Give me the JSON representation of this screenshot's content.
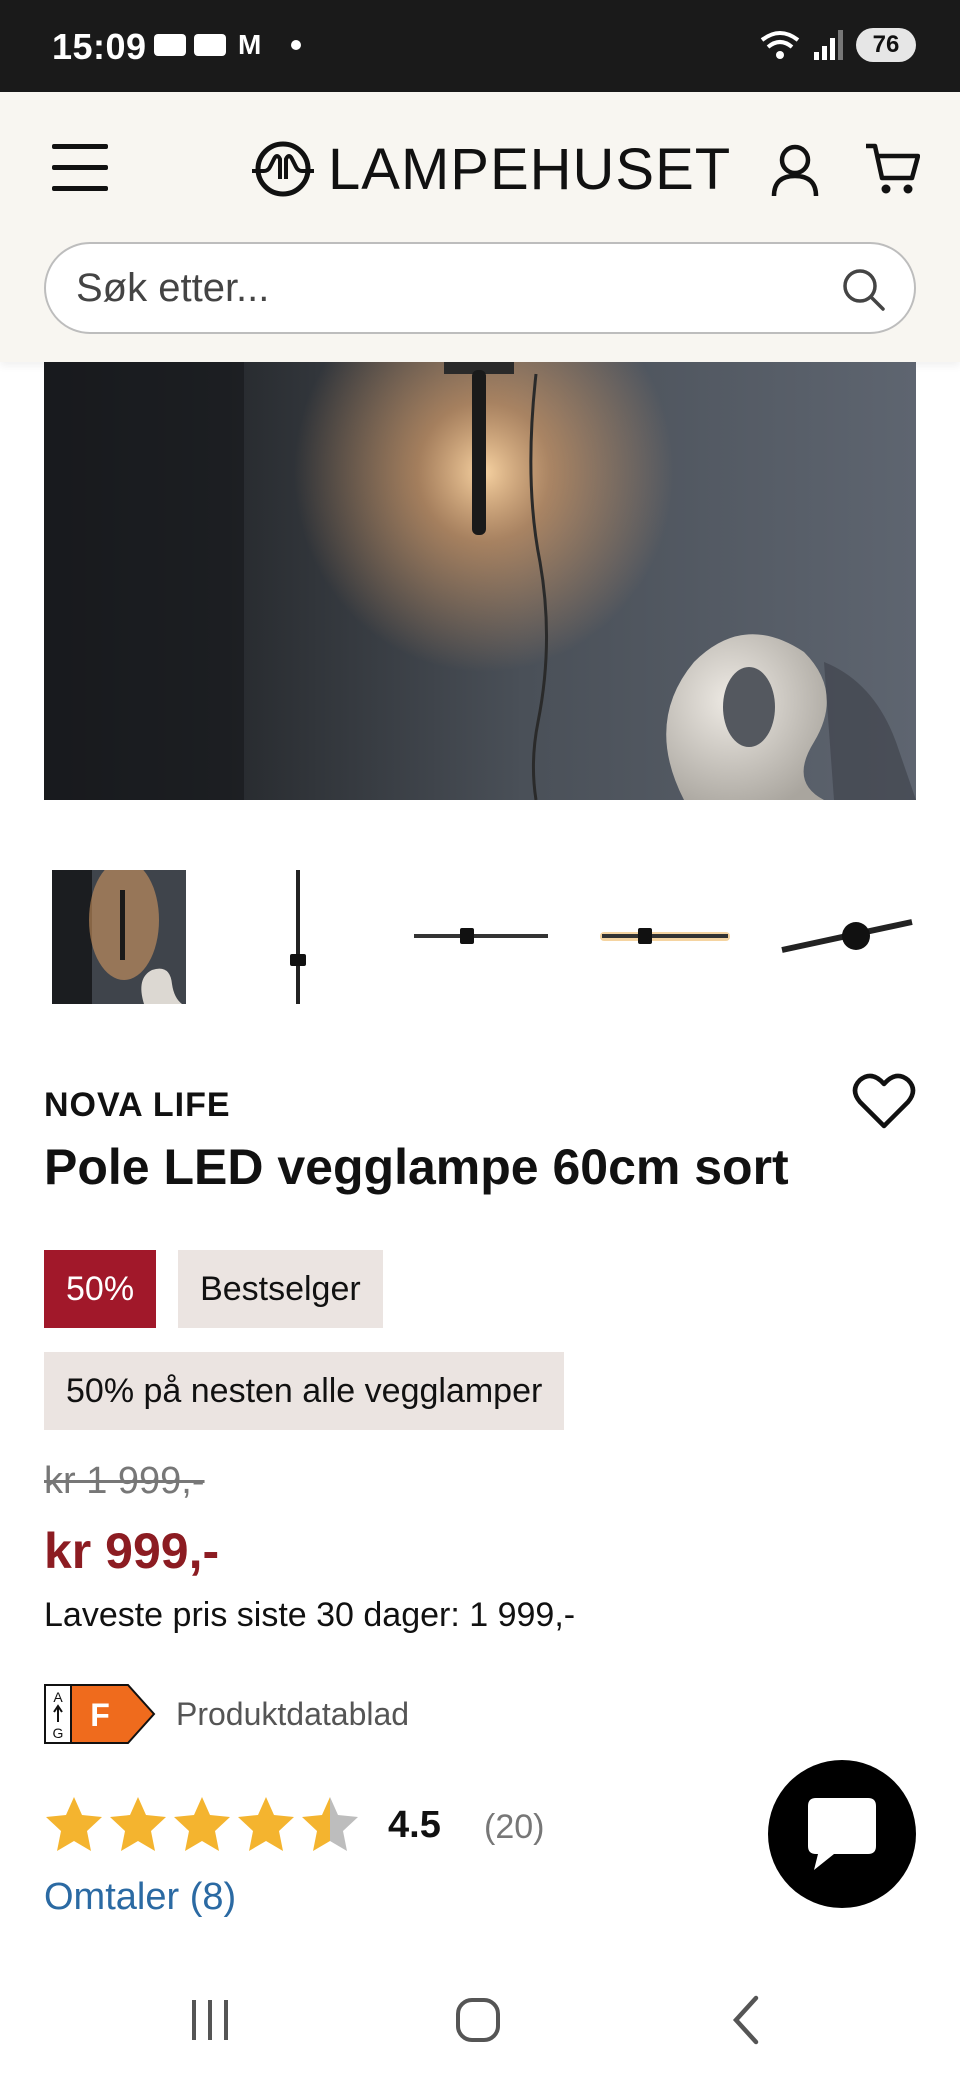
{
  "status_bar": {
    "time": "15:09",
    "notification_icon": "M",
    "battery": "76"
  },
  "header": {
    "brand_name": "LAMPEHUSET",
    "search_placeholder": "Søk etter..."
  },
  "product": {
    "brand": "NOVA LIFE",
    "title": "Pole LED vegglampe 60cm sort",
    "badges": {
      "discount": "50%",
      "bestseller": "Bestselger"
    },
    "promo": "50% på nesten alle vegglamper",
    "old_price": "kr 1 999,-",
    "new_price": "kr 999,-",
    "lowest_price": "Laveste pris siste 30 dager: 1 999,-",
    "energy_label": {
      "scale_top": "A",
      "scale_bottom": "G",
      "class": "F",
      "color": "#ef6b1d"
    },
    "datasheet_link": "Produktdatablad",
    "rating": {
      "stars": 4.5,
      "value": "4.5",
      "count": "(20)",
      "star_color": "#f4b42f"
    },
    "reviews_link": "Omtaler (8)"
  },
  "colors": {
    "sale_red": "#a1182a",
    "price_red": "#8c1c22",
    "link_blue": "#2b6aa3",
    "header_bg": "#f8f6f1"
  }
}
